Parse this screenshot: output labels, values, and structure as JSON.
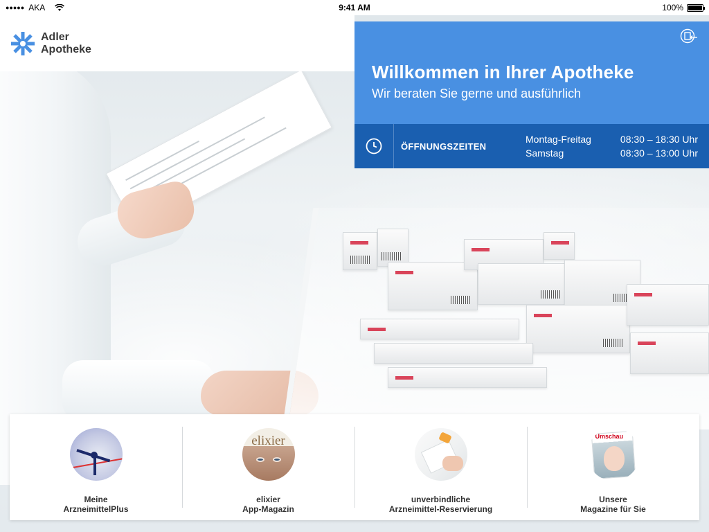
{
  "statusbar": {
    "carrier": "AKA",
    "time": "9:41 AM",
    "battery": "100%",
    "battery_level": 1.0
  },
  "logo": {
    "line1": "Adler",
    "line2": "Apotheke",
    "color": "#4990e2"
  },
  "welcome": {
    "title": "Willkommen in Ihrer Apotheke",
    "subtitle": "Wir beraten Sie gerne und ausführlich",
    "bg": "#4990e2"
  },
  "hours": {
    "label": "ÖFFNUNGSZEITEN",
    "bg": "#1a5fb0",
    "rows": [
      {
        "day": "Montag-Freitag",
        "time": "08:30 – 18:30 Uhr"
      },
      {
        "day": "Samstag",
        "time": "08:30 – 13:00 Uhr"
      }
    ]
  },
  "tiles": [
    {
      "line1": "Meine",
      "line2": "ArzneimittelPlus"
    },
    {
      "line1": "elixier",
      "line2": "App-Magazin",
      "image_text": "elixier"
    },
    {
      "line1": "unverbindliche",
      "line2": "Arzneimittel-Reservierung"
    },
    {
      "line1": "Unsere",
      "line2": "Magazine für Sie",
      "image_text": "Umschau"
    }
  ]
}
